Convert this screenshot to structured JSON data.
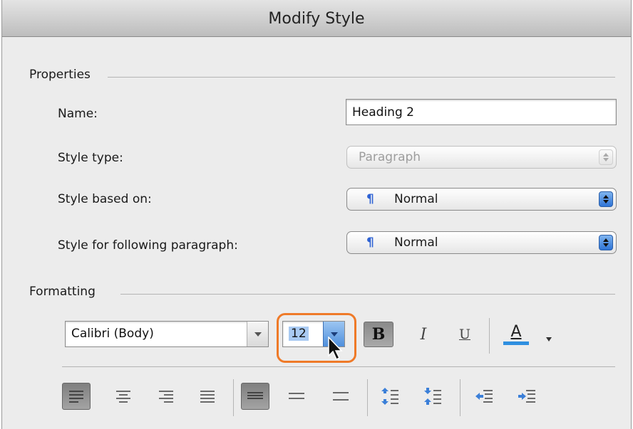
{
  "dialog": {
    "title": "Modify Style"
  },
  "properties": {
    "group_label": "Properties",
    "name_label": "Name:",
    "name_value": "Heading 2",
    "style_type_label": "Style type:",
    "style_type_value": "Paragraph",
    "based_on_label": "Style based on:",
    "based_on_value": "Normal",
    "following_label": "Style for following paragraph:",
    "following_value": "Normal",
    "paragraph_mark": "¶"
  },
  "formatting": {
    "group_label": "Formatting",
    "font_name": "Calibri (Body)",
    "font_size": "12",
    "bold_label": "B",
    "italic_label": "I",
    "underline_label": "U",
    "font_color_label": "A",
    "font_color_accent": "#2f8fe0",
    "highlight_color": "#ef7a28"
  },
  "icons": {
    "align": [
      "align-left-icon",
      "align-center-icon",
      "align-right-icon",
      "align-justify-icon"
    ],
    "spacing": [
      "single-spacing-icon",
      "one-half-spacing-icon",
      "double-spacing-icon"
    ],
    "paragraph_spacing": [
      "increase-paragraph-spacing-icon",
      "decrease-paragraph-spacing-icon"
    ],
    "indent": [
      "decrease-indent-icon",
      "increase-indent-icon"
    ]
  }
}
